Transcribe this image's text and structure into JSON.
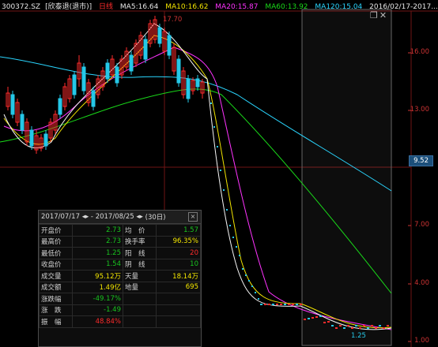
{
  "header": {
    "code": "300372.SZ",
    "name": "[欣泰退(退市)]",
    "period": "日线",
    "ma5": "MA5:16.64",
    "ma10": "MA10:16.62",
    "ma20": "MA20:15.87",
    "ma60": "MA60:13.92",
    "ma120": "MA120:15.04",
    "date": "2016/02/17-2017..."
  },
  "colors": {
    "ma5": "#f7f7f7",
    "ma10": "#f3e600",
    "ma20": "#ff33ff",
    "ma60": "#19d919",
    "ma120": "#2ad6ff",
    "up": "#ff2b2b",
    "down": "#25c8e8",
    "grid": "#701414"
  },
  "axis": {
    "labels": [
      "16.00",
      "13.00",
      "7.00",
      "4.00",
      "1.00"
    ],
    "current_price": "9.52"
  },
  "chart_annotations": {
    "high": "17.70",
    "low": "1.25"
  },
  "selection_icons": [
    "restore-icon",
    "close-icon"
  ],
  "panel": {
    "range": "2017/07/17 ◂▸ - 2017/08/25 ◂▸",
    "days": "(30日)",
    "close_glyph": "×",
    "rows": [
      {
        "k1": "开盘价",
        "v1": "2.73",
        "c1": "g",
        "k2": "均　价",
        "v2": "1.57",
        "c2": "g"
      },
      {
        "k1": "最高价",
        "v1": "2.73",
        "c1": "g",
        "k2": "换手率",
        "v2": "96.35%",
        "c2": "y"
      },
      {
        "k1": "最低价",
        "v1": "1.25",
        "c1": "g",
        "k2": "阳　线",
        "v2": "20",
        "c2": "r"
      },
      {
        "k1": "收盘价",
        "v1": "1.54",
        "c1": "g",
        "k2": "阴　线",
        "v2": "10",
        "c2": "g"
      },
      {
        "k1": "成交量",
        "v1": "95.12万",
        "c1": "y",
        "k2": "天量",
        "v2": "18.14万",
        "c2": "y"
      },
      {
        "k1": "成交额",
        "v1": "1.49亿",
        "c1": "y",
        "k2": "地量",
        "v2": "695",
        "c2": "y"
      },
      {
        "k1": "涨跌幅",
        "v1": "-49.17%",
        "c1": "g",
        "k2": "",
        "v2": "",
        "c2": "g"
      },
      {
        "k1": "涨　跌",
        "v1": "-1.49",
        "c1": "g",
        "k2": "",
        "v2": "",
        "c2": "g"
      },
      {
        "k1": "振　幅",
        "v1": "48.84%",
        "c1": "r",
        "k2": "",
        "v2": "",
        "c2": "g"
      }
    ]
  }
}
